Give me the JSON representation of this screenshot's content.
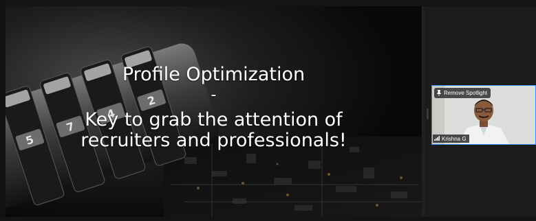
{
  "slide": {
    "title_line1": "Profile Optimization",
    "title_dash": "-",
    "title_line2": "Key to grab the attention of",
    "title_line3": "recruiters and professionals!"
  },
  "participant": {
    "name": "Krishna G",
    "remove_spotlight_label": "Remove Spotlight",
    "spotlight_icon": "pin-icon",
    "signal_icon": "signal-bars-icon",
    "active_border_color": "#2d8cff"
  }
}
